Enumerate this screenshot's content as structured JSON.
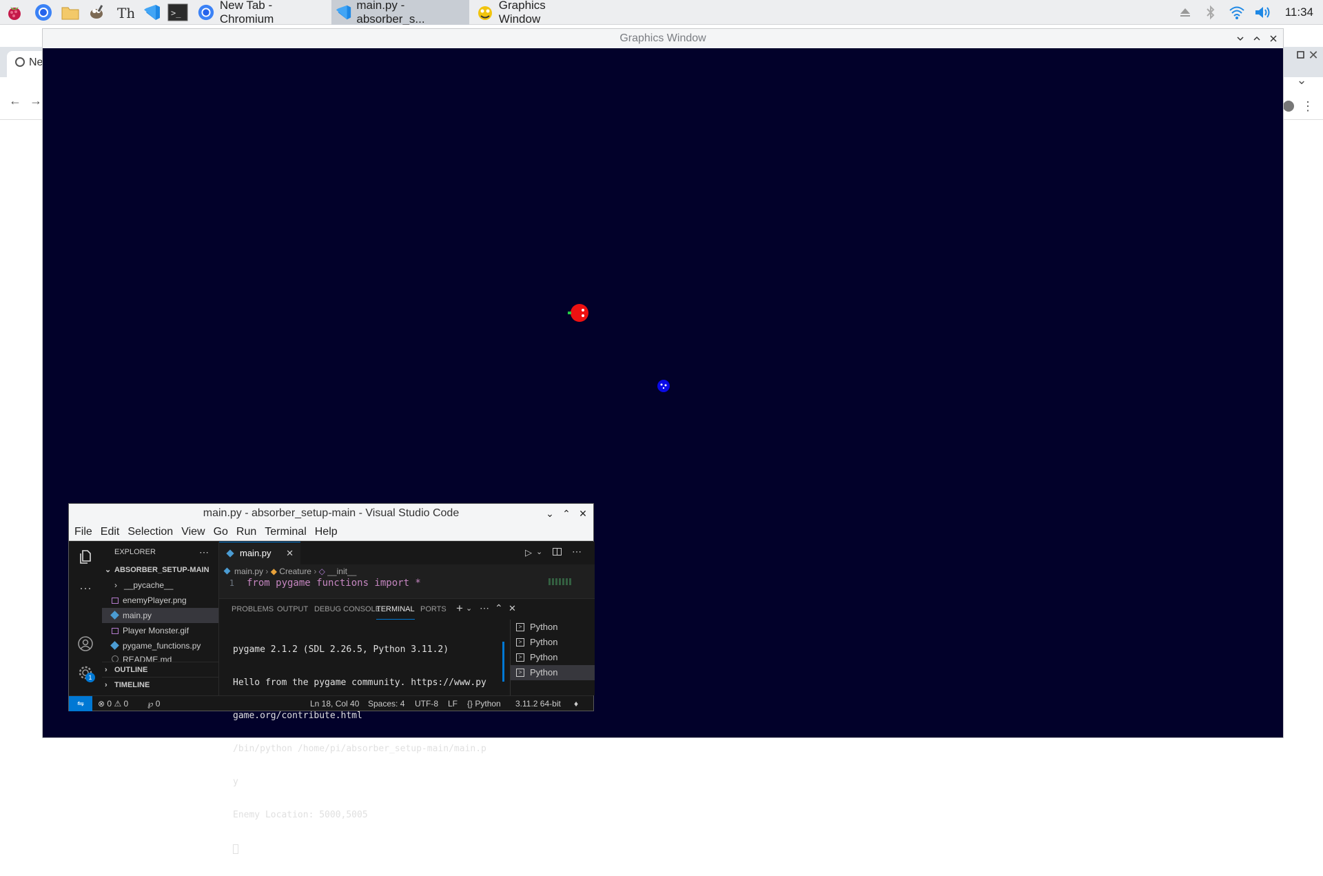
{
  "taskbar": {
    "tasks": [
      {
        "label": "New Tab - Chromium",
        "active": false
      },
      {
        "label": "main.py - absorber_s...",
        "active": true
      },
      {
        "label": "Graphics Window",
        "active": false
      }
    ],
    "clock": "11:34"
  },
  "browser": {
    "tab_label": "Ne"
  },
  "graphics_window": {
    "title": "Graphics Window",
    "background_color": "#02012a",
    "player_color": "#ee1111",
    "enemy_color": "#0a0ae6"
  },
  "vscode": {
    "title": "main.py - absorber_setup-main - Visual Studio Code",
    "menu": [
      "File",
      "Edit",
      "Selection",
      "View",
      "Go",
      "Run",
      "Terminal",
      "Help"
    ],
    "explorer": {
      "header": "EXPLORER",
      "folder": "ABSORBER_SETUP-MAIN",
      "items": [
        "__pycache__",
        "enemyPlayer.png",
        "main.py",
        "Player Monster.gif",
        "pygame_functions.py",
        "README.md"
      ],
      "outline": "OUTLINE",
      "timeline": "TIMELINE"
    },
    "editor": {
      "tab": "main.py",
      "crumbs": [
        "main.py",
        "Creature",
        "__init__"
      ],
      "line_number": "1",
      "code": "from pygame_functions import *"
    },
    "panel": {
      "tabs": [
        "PROBLEMS",
        "OUTPUT",
        "DEBUG CONSOLE",
        "TERMINAL",
        "PORTS"
      ],
      "active_tab": "TERMINAL",
      "terminal_lines": [
        "pygame 2.1.2 (SDL 2.26.5, Python 3.11.2)",
        "Hello from the pygame community. https://www.py",
        "game.org/contribute.html",
        "/bin/python /home/pi/absorber_setup-main/main.p",
        "y",
        "Enemy Location: 5000,5005"
      ],
      "terminals": [
        "Python",
        "Python",
        "Python",
        "Python"
      ]
    },
    "status": {
      "errors": "0",
      "warnings": "0",
      "ports": "0",
      "position": "Ln 18, Col 40",
      "spaces": "Spaces: 4",
      "encoding": "UTF-8",
      "eol": "LF",
      "language": "Python",
      "interpreter": "3.11.2 64-bit",
      "badge": "1"
    }
  }
}
